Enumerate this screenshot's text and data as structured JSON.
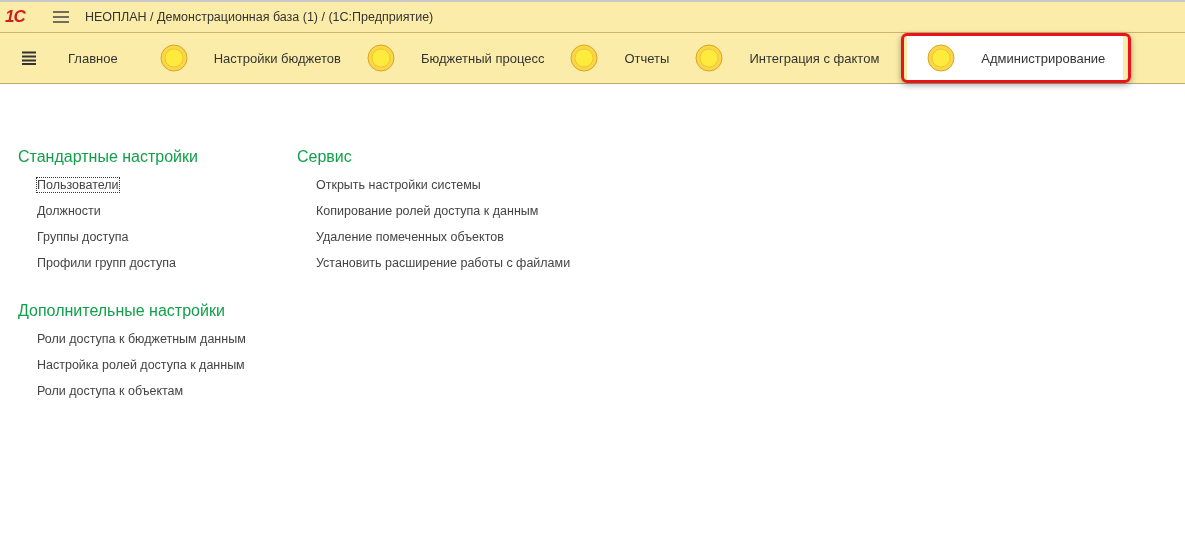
{
  "window": {
    "logo": "1С",
    "title": "НЕОПЛАН / Демонстрационная база (1) /  (1С:Предприятие)"
  },
  "sections": [
    {
      "label": "Главное",
      "kind": "plain",
      "selected": false,
      "highlighted": false
    },
    {
      "label": "Настройки бюджетов",
      "kind": "circle",
      "selected": false,
      "highlighted": false
    },
    {
      "label": "Бюджетный процесс",
      "kind": "circle",
      "selected": false,
      "highlighted": false
    },
    {
      "label": "Отчеты",
      "kind": "circle",
      "selected": false,
      "highlighted": false
    },
    {
      "label": "Интеграция с фактом",
      "kind": "circle",
      "selected": false,
      "highlighted": false
    },
    {
      "label": "Администрирование",
      "kind": "circle",
      "selected": true,
      "highlighted": true
    }
  ],
  "columns": [
    {
      "groups": [
        {
          "title": "Стандартные настройки",
          "links": [
            {
              "label": "Пользователи",
              "focused": true
            },
            {
              "label": "Должности",
              "focused": false
            },
            {
              "label": "Группы доступа",
              "focused": false
            },
            {
              "label": "Профили групп доступа",
              "focused": false
            }
          ]
        },
        {
          "title": "Дополнительные настройки",
          "links": [
            {
              "label": "Роли доступа к бюджетным данным",
              "focused": false
            },
            {
              "label": "Настройка ролей доступа к данным",
              "focused": false
            },
            {
              "label": "Роли доступа к объектам",
              "focused": false
            }
          ]
        }
      ]
    },
    {
      "groups": [
        {
          "title": "Сервис",
          "links": [
            {
              "label": "Открыть настройки системы",
              "focused": false
            },
            {
              "label": "Копирование ролей доступа к данным",
              "focused": false
            },
            {
              "label": "Удаление помеченных объектов",
              "focused": false
            },
            {
              "label": "Установить расширение работы с файлами",
              "focused": false
            }
          ]
        }
      ]
    }
  ]
}
